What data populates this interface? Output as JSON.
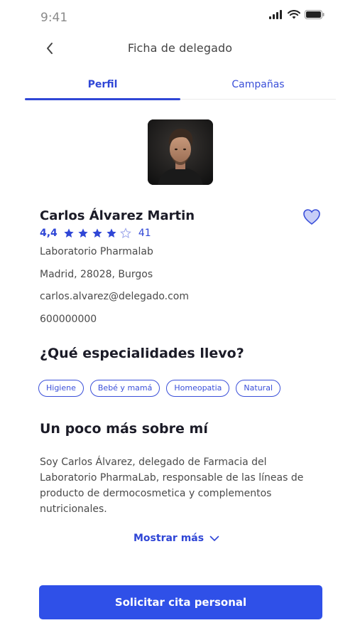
{
  "status_bar": {
    "time": "9:41"
  },
  "nav": {
    "title": "Ficha de delegado"
  },
  "tabs": [
    {
      "label": "Perfil",
      "active": true
    },
    {
      "label": "Campañas",
      "active": false
    }
  ],
  "profile": {
    "name": "Carlos Álvarez Martin",
    "rating_value": "4,4",
    "rating_stars": 4,
    "rating_max": 5,
    "rating_count": "41",
    "lab": "Laboratorio Pharmalab",
    "address": "Madrid, 28028, Burgos",
    "email": "carlos.alvarez@delegado.com",
    "phone": "600000000"
  },
  "specialties": {
    "title": "¿Qué especialidades llevo?",
    "chips": [
      "Higiene",
      "Bebé y mamá",
      "Homeopatia",
      "Natural"
    ]
  },
  "about": {
    "title": "Un poco más sobre mí",
    "text": "Soy Carlos Álvarez, delegado de Farmacia del Laboratorio PharmaLab, responsable de las líneas de producto de dermocosmetica y complementos nutricionales.",
    "show_more": "Mostrar más"
  },
  "cta": {
    "label": "Solicitar cita personal"
  },
  "colors": {
    "accent": "#2f46d6",
    "cta_bg": "#2f50e8"
  }
}
